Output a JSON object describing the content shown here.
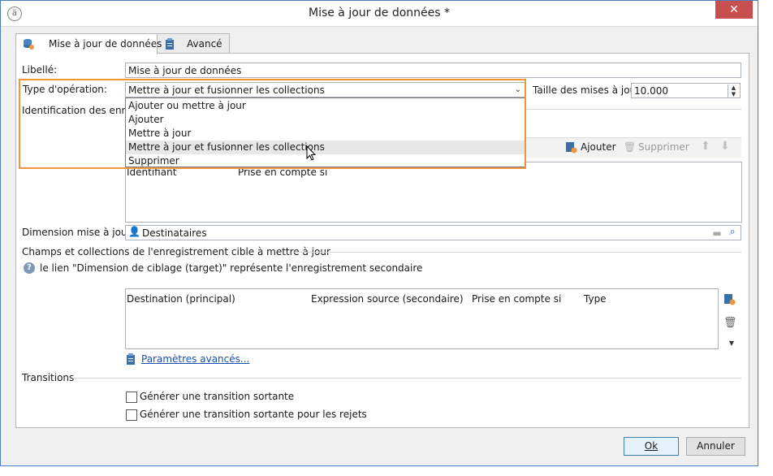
{
  "window": {
    "title": "Mise à jour de données *",
    "close_glyph": "✕",
    "app_icon_glyph": "ä"
  },
  "tabs": [
    {
      "label": "Mise à jour de données"
    },
    {
      "label": "Avancé"
    }
  ],
  "form": {
    "libelle_label": "Libellé:",
    "libelle_value": "Mise à jour de données",
    "type_label": "Type d'opération:",
    "type_value": "Mettre à jour et fusionner les collections",
    "batch_label": "Taille des mises à jour:",
    "batch_value": "10.000",
    "identification_label": "Identification des enregi"
  },
  "dropdown": {
    "options": [
      "Ajouter ou mettre à jour",
      "Ajouter",
      "Mettre à jour",
      "Mettre à jour et fusionner les collections",
      "Supprimer"
    ],
    "hovered_index": 3
  },
  "toolbar": {
    "add_label": "Ajouter",
    "delete_label": "Supprimer"
  },
  "ident_grid": {
    "headers": [
      "Identifiant",
      "Prise en compte si"
    ]
  },
  "dimension": {
    "label": "Dimension mise à jour:",
    "value": "Destinataires"
  },
  "fields_section": {
    "title": "Champs et collections de l'enregistrement cible à mettre à jour",
    "help_text": "le lien \"Dimension de ciblage (target)\" représente l'enregistrement secondaire",
    "help_glyph": "?",
    "headers": [
      "Destination (principal)",
      "Expression source (secondaire)",
      "Prise en compte si",
      "Type"
    ],
    "advanced_link": "Paramètres avancés..."
  },
  "transitions": {
    "title": "Transitions",
    "checkbox1": "Générer une transition sortante",
    "checkbox2": "Générer une transition sortante pour les rejets"
  },
  "buttons": {
    "ok": "Ok",
    "cancel": "Annuler"
  },
  "colors": {
    "highlight_border": "#f0953a",
    "link": "#1a4fb0",
    "close_button": "#c74f4f"
  }
}
